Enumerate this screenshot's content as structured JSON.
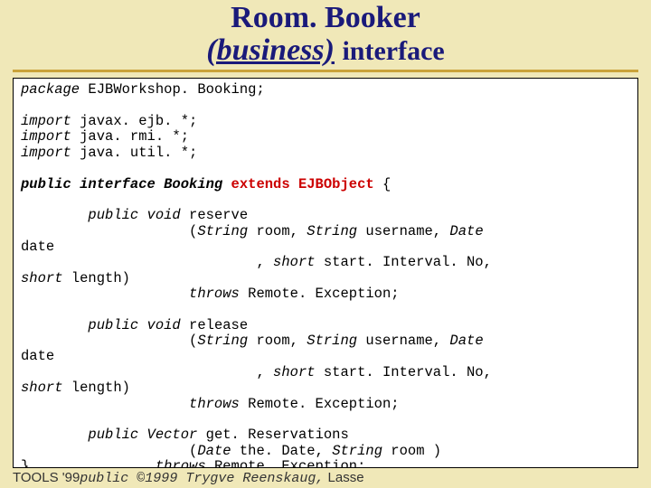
{
  "header": {
    "line1": "Room. Booker",
    "line2_biz": "(business)",
    "line2_iface": "interface"
  },
  "code": {
    "pkg": "package",
    "pkg_name": " EJBWorkshop. Booking;",
    "imp": "import",
    "imp1": " javax. ejb. *;",
    "imp2": " java. rmi. *;",
    "imp3": " java. util. *;",
    "pub_if": "public interface Booking ",
    "extends": "extends EJBObject",
    "brace": " {",
    "m1a": "        public void reserve",
    "m1b": "                    (String room, String username, Date",
    "m1c": "date",
    "m1d": "                            , short start. Interval. No,",
    "m1e": "short length)",
    "m1f": "                    throws Remote. Exception;",
    "m2a": "        public void release",
    "m2b": "                    (String room, String username, Date",
    "m2c": "date",
    "m2d": "                            , short start. Interval. No,",
    "m2e": "short length)",
    "m2f": "                    throws Remote. Exception;",
    "m3a": "        public Vector get. Reservations",
    "m3b": "                    (Date the. Date, String room )",
    "m3c": "}               throws Remote. Exception;",
    "m4a": "        public ©1999 Trygve Reenskaug,",
    "m4b": "                    throws Remote. Exception;",
    "pv": "public void",
    "str": "String",
    "date": "Date",
    "sh": "short",
    "pv_vec": "public Vector",
    "thr": "throws"
  },
  "footer": {
    "left": "TOOLS '99",
    "mid_mono": "public ©1999 Trygve Reenskaug,",
    "right": " Lasse",
    "cut": "                    throws Remote Exception:"
  },
  "chart_data": null
}
